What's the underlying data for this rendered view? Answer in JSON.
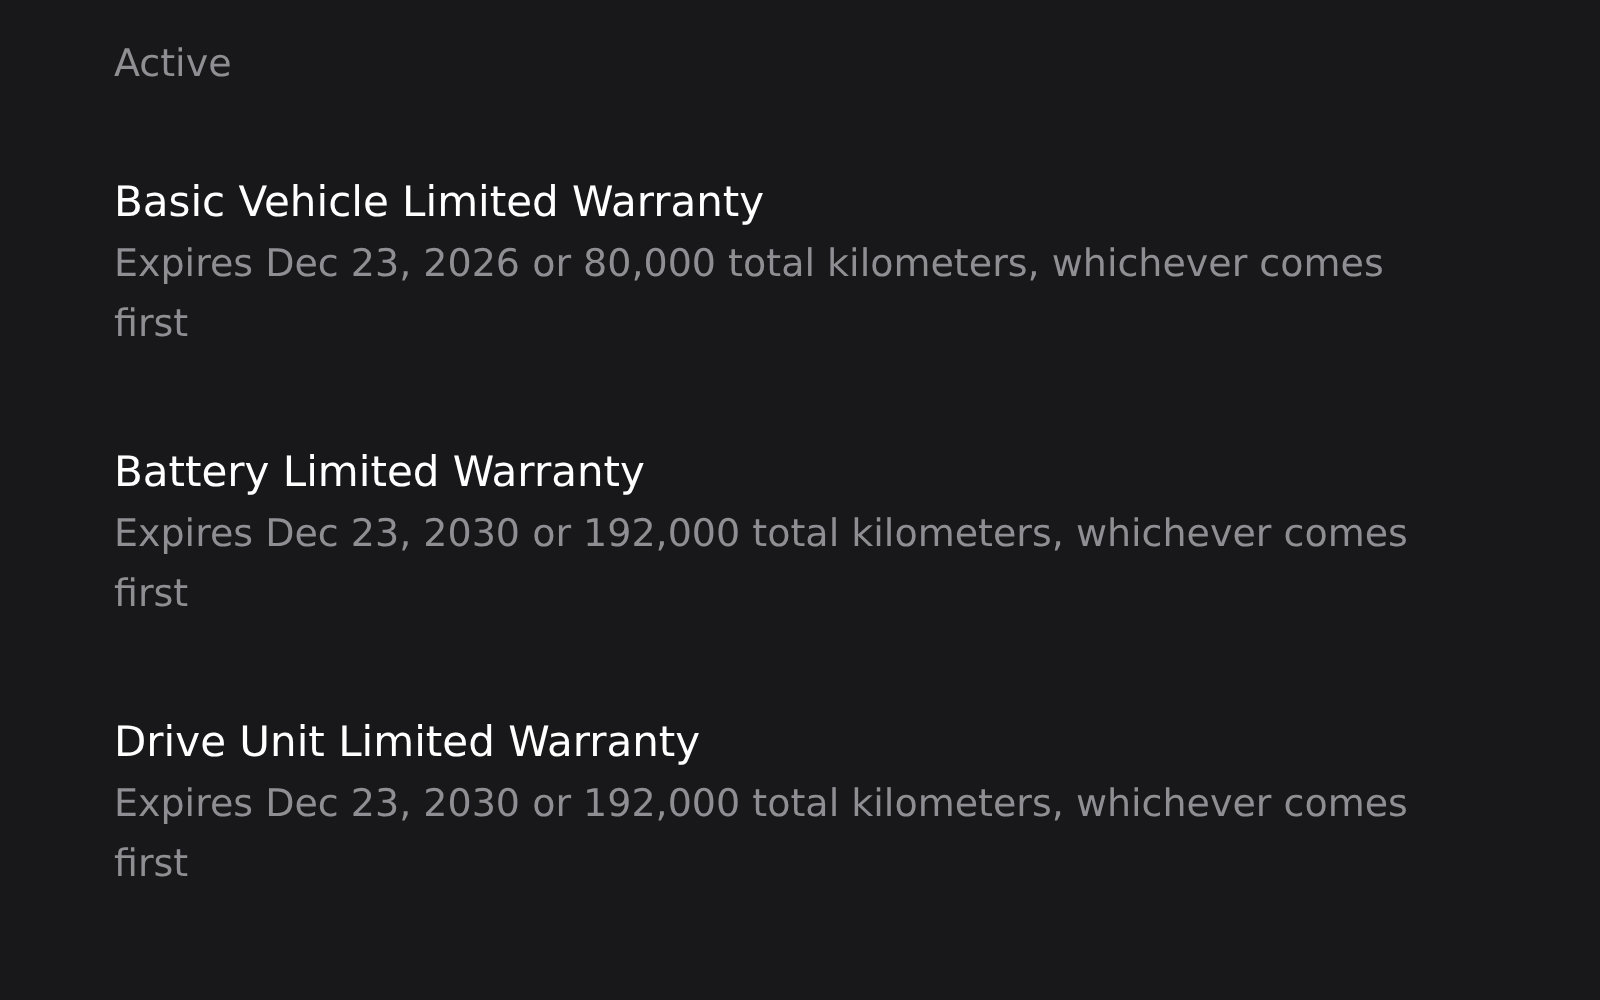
{
  "section": {
    "title": "Active"
  },
  "warranties": [
    {
      "name": "Basic Vehicle Limited Warranty",
      "detail": "Expires Dec 23, 2026 or 80,000 total kilometers, whichever comes first"
    },
    {
      "name": "Battery Limited Warranty",
      "detail": "Expires Dec 23, 2030 or 192,000 total kilometers, whichever comes first"
    },
    {
      "name": "Drive Unit Limited Warranty",
      "detail": "Expires Dec 23, 2030 or 192,000 total kilometers, whichever comes first"
    }
  ]
}
